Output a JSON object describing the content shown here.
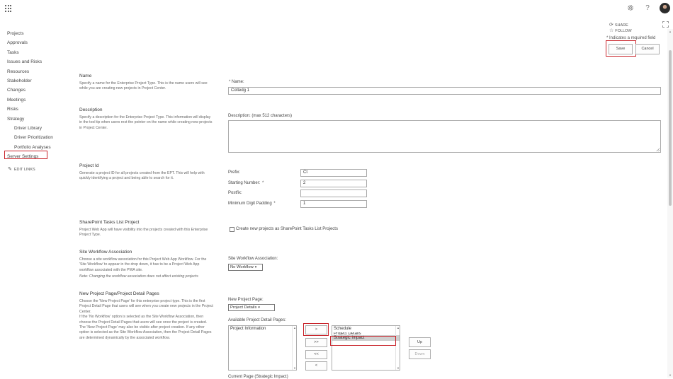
{
  "topbar": {
    "settings_icon": "gear-icon",
    "help_icon": "question-icon",
    "help_glyph": "?",
    "share_label": "SHARE",
    "follow_label": "FOLLOW"
  },
  "nav": {
    "items": [
      "Projects",
      "Approvals",
      "Tasks",
      "Issues and Risks",
      "Resources",
      "Stakeholder",
      "Changes",
      "Meetings",
      "Risks",
      "Strategy",
      "Driver Library",
      "Driver Prioritization",
      "Portfolio Analyses",
      "Server Settings"
    ],
    "edit_links": "EDIT LINKS"
  },
  "required_note": "* Indicates a required field",
  "buttons": {
    "save": "Save",
    "cancel": "Cancel"
  },
  "name_section": {
    "title": "Name",
    "desc": "Specify a name for the Enterprise Project Type. This is the name users will see while you are creating new projects in Project Center.",
    "label": "Name:",
    "value": "Cottedg 1"
  },
  "description_section": {
    "title": "Description",
    "desc": "Specify a description for the Enterprise Project Type. This information will display in the tool tip when users rest the pointer on the name while creating new projects in Project Center.",
    "label": "Description: (max 512 characters)"
  },
  "project_id_section": {
    "title": "Project Id",
    "desc": "Generate a project ID for all projects created from the EPT. This will help with quickly identifying a project and being able to search for it.",
    "prefix_label": "Prefix:",
    "prefix_value": "Ct",
    "starting_label": "Starting Number:",
    "starting_value": "2",
    "postfix_label": "Postfix:",
    "postfix_value": "",
    "padding_label": "Minimum Digit Padding",
    "padding_value": "1"
  },
  "sharepoint_section": {
    "title": "SharePoint Tasks List Project",
    "desc": "Project Web App will have visibility into the projects created with this Enterprise Project Type.",
    "checkbox_label": "Create new projects as SharePoint Tasks List Projects"
  },
  "workflow_section": {
    "title": "Site Workflow Association",
    "desc": "Choose a site workflow association for this Project Web App Workflow. For the 'Site Workflow' to appear in the drop down, it has to be a Project Web App workflow associated with the PWA site.",
    "note": "Note: Changing the workflow association does not affect existing projects",
    "label": "Site Workflow Association:",
    "value": "No Workflow"
  },
  "pdp_section": {
    "title": "New Project Page/Project Detail Pages",
    "desc": "Choose the 'New Project Page' for this enterprise project type. This is the first Project Detail Page that users will see when you create new projects in the Project Center.\nIf the 'No Workflow' option is selected as the Site Workflow Association, then choose the Project Detail Pages that users will see once the project is created.\nThe 'New Project Page' may also be visible after project creation. If any other option is selected as the Site Workflow Association, then the Project Detail Pages are determined dynamically by the associated workflow.",
    "new_page_label": "New Project Page:",
    "new_page_value": "Project Details",
    "available_label": "Available Project Detail Pages:",
    "available_items": [
      "Project Information"
    ],
    "selected_items": [
      "Schedule",
      "Project Details",
      "Strategic Impact"
    ],
    "btn_add": ">",
    "btn_add_all": ">>",
    "btn_remove_all": "<<",
    "btn_remove": "<",
    "btn_up": "Up",
    "btn_down": "Down",
    "current_page_label": "Current Page (Strategic Impact)"
  },
  "colors": {
    "highlight": "#c9242b",
    "text": "#333333",
    "muted": "#666666"
  }
}
